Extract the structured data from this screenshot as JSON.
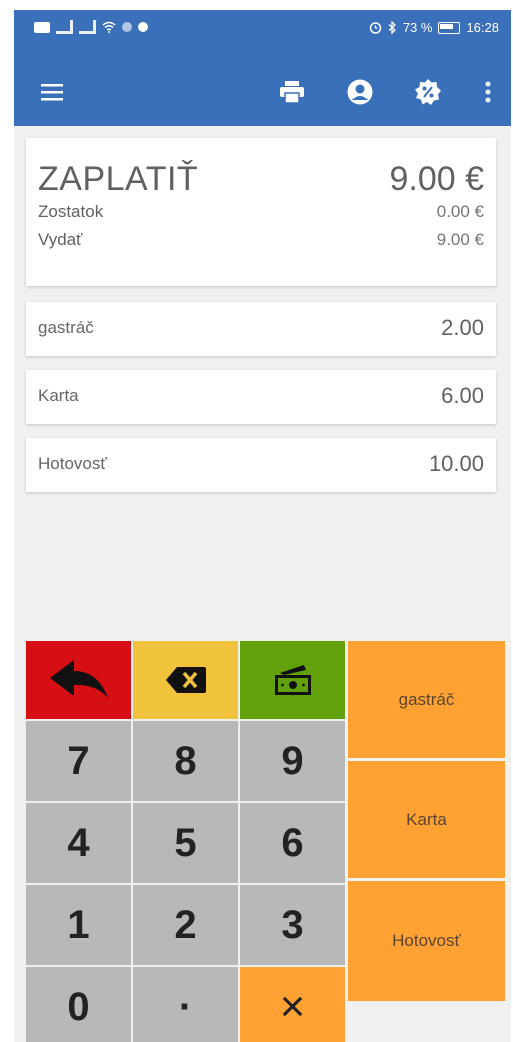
{
  "status_bar": {
    "time": "16:28",
    "battery": "73 %"
  },
  "colors": {
    "app_bar": "#3a6fb9",
    "undo_key": "#d50f14",
    "backspace_key": "#f1c23c",
    "cash_key": "#63a10b",
    "accent_orange": "#ffa233",
    "digit_key": "#b8b8b8"
  },
  "toolbar": {
    "icons": [
      "menu-icon",
      "printer-icon",
      "account-icon",
      "discount-icon",
      "more-vert-icon"
    ]
  },
  "summary": {
    "title": "ZAPLATIŤ",
    "total": "9.00 €",
    "rows": [
      {
        "label": "Zostatok",
        "value": "0.00  €"
      },
      {
        "label": "Vydať",
        "value": "9.00  €"
      }
    ]
  },
  "payments": [
    {
      "label": "gastráč",
      "amount": "2.00"
    },
    {
      "label": "Karta",
      "amount": "6.00"
    },
    {
      "label": "Hotovosť",
      "amount": "10.00"
    }
  ],
  "keypad": {
    "top_icons": [
      "undo-arrow-icon",
      "backspace-icon",
      "cash-register-icon"
    ],
    "digits": [
      "7",
      "8",
      "9",
      "4",
      "5",
      "6",
      "1",
      "2",
      "3",
      "0",
      "·"
    ],
    "clear": "×",
    "methods": [
      "gastráč",
      "Karta",
      "Hotovosť"
    ]
  }
}
